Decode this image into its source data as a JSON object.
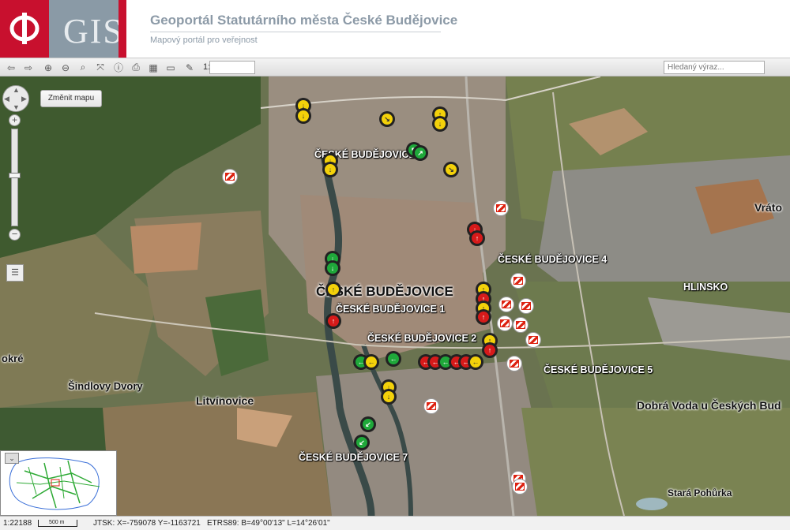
{
  "header": {
    "logo_text": "GIS",
    "title": "Geoportál Statutárního města České Budějovice",
    "subtitle": "Mapový portál pro veřejnost"
  },
  "toolbar": {
    "buttons": [
      "arrow-left-icon",
      "arrow-right-icon",
      "zoom-in-icon",
      "zoom-out-icon",
      "zoom-search-icon",
      "full-extent-icon",
      "info-icon",
      "print-icon",
      "measure-icon",
      "settings-icon"
    ],
    "scale_prefix": "1:",
    "scale_value": "",
    "search_placeholder": "Hledaný výraz..."
  },
  "map": {
    "change_map_button": "Změnit mapu",
    "zoom_in": "+",
    "zoom_out": "−",
    "labels": [
      {
        "text": "ČESKÉ BUDĚJOVICE 3",
        "cls": "label"
      },
      {
        "text": "ČESKÉ BUDĚJOVICE 4",
        "cls": "label"
      },
      {
        "text": "ČESKÉ BUDĚJOVICE",
        "cls": "label big"
      },
      {
        "text": "ČESKÉ BUDĚJOVICE 1",
        "cls": "label"
      },
      {
        "text": "ČESKÉ BUDĚJOVICE 2",
        "cls": "label"
      },
      {
        "text": "ČESKÉ BUDĚJOVICE 5",
        "cls": "label"
      },
      {
        "text": "ČESKÉ BUDĚJOVICE 7",
        "cls": "label"
      },
      {
        "text": "HLINSKO",
        "cls": "label"
      },
      {
        "text": "Vráto",
        "cls": "label dark"
      },
      {
        "text": "okré",
        "cls": "label dark"
      },
      {
        "text": "Šindlovy Dvory",
        "cls": "label dark"
      },
      {
        "text": "Litvínovice",
        "cls": "label dark"
      },
      {
        "text": "Dobrá Voda u Českých Bud",
        "cls": "label dark"
      },
      {
        "text": "Stará Pohůrka",
        "cls": "label dark"
      }
    ]
  },
  "status": {
    "scale": "1:22188",
    "scalebar_label": "500 m",
    "jtsk": "JTSK: X=-759078 Y=-1163721",
    "etrs": "ETRS89: B=49°00'13\" L=14°26'01\""
  },
  "colors": {
    "brand_red": "#c8102e",
    "brand_gray": "#8a9aa6",
    "marker_yellow": "#f3d10a",
    "marker_green": "#1fa83a",
    "marker_red": "#d61a1a"
  }
}
